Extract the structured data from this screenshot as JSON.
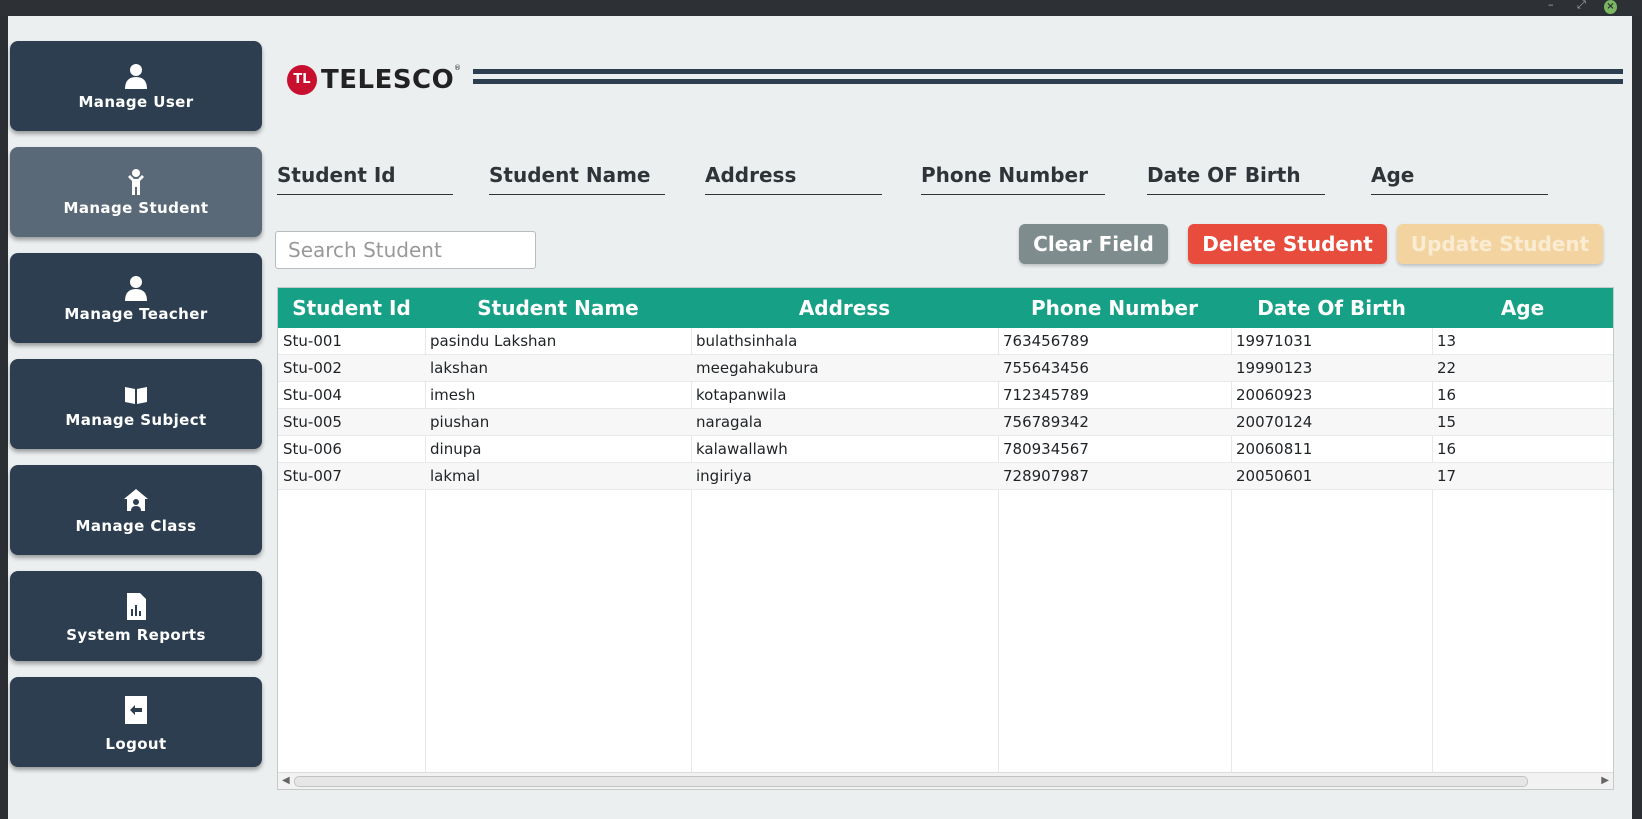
{
  "window": {
    "controls": {
      "minimize": "–",
      "maximize": "⤢",
      "close": "×"
    }
  },
  "sidebar": {
    "items": [
      {
        "label": "Manage User",
        "icon": "user-icon",
        "active": false
      },
      {
        "label": "Manage Student",
        "icon": "student-icon",
        "active": true
      },
      {
        "label": "Manage Teacher",
        "icon": "teacher-icon",
        "active": false
      },
      {
        "label": "Manage Subject",
        "icon": "book-icon",
        "active": false
      },
      {
        "label": "Manage Class",
        "icon": "class-icon",
        "active": false
      },
      {
        "label": "System Reports",
        "icon": "report-icon",
        "active": false
      },
      {
        "label": "Logout",
        "icon": "logout-icon",
        "active": false
      }
    ]
  },
  "header": {
    "logo_badge": "TL",
    "logo_text": "TELESCO",
    "logo_mark": "®"
  },
  "form": {
    "fields": [
      "Student Id",
      "Student Name",
      "Address",
      "Phone Number",
      "Date OF Birth",
      "Age"
    ]
  },
  "search": {
    "placeholder": "Search Student",
    "value": ""
  },
  "actions": {
    "clear_label": "Clear Field",
    "delete_label": "Delete Student",
    "update_label": "Update Student"
  },
  "table": {
    "columns": [
      "Student Id",
      "Student Name",
      "Address",
      "Phone Number",
      "Date Of Birth",
      "Age"
    ],
    "rows": [
      [
        "Stu-001",
        "pasindu Lakshan",
        "bulathsinhala",
        "763456789",
        "19971031",
        "13"
      ],
      [
        "Stu-002",
        "lakshan",
        "meegahakubura",
        "755643456",
        "19990123",
        "22"
      ],
      [
        "Stu-004",
        "imesh",
        "kotapanwila",
        "712345789",
        "20060923",
        "16"
      ],
      [
        "Stu-005",
        "piushan",
        "naragala",
        "756789342",
        "20070124",
        "15"
      ],
      [
        "Stu-006",
        "dinupa",
        "kalawallawh",
        "780934567",
        "20060811",
        "16"
      ],
      [
        "Stu-007",
        "lakmal",
        "ingiriya",
        "728907987",
        "20050601",
        "17"
      ]
    ]
  },
  "colors": {
    "nav": "#2c3e50",
    "nav_active": "#5a6978",
    "table_header": "#16a085",
    "clear": "#7f8c8d",
    "delete": "#e74c3c",
    "update_disabled": "#f3d4a0"
  }
}
